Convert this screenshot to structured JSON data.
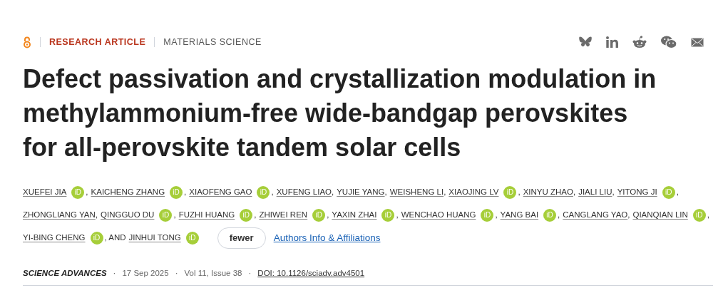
{
  "header": {
    "article_type": "RESEARCH ARTICLE",
    "subject": "MATERIALS SCIENCE"
  },
  "title": "Defect passivation and crystallization modulation in methylammonium-free wide-bandgap perovskites for all-perovskite tandem solar cells",
  "author_lines": [
    [
      {
        "name": "XUEFEI JIA",
        "orcid_badge": "iD",
        "after": ","
      },
      {
        "name": "KAICHENG ZHANG",
        "orcid_badge": "iD",
        "after": ","
      },
      {
        "name": "XIAOFENG GAO",
        "orcid_badge": "iD",
        "after": ","
      },
      {
        "name": "XUFENG LIAO",
        "after": ","
      },
      {
        "name": "YUJIE YANG",
        "after": ","
      },
      {
        "name": "WEISHENG LI",
        "after": ","
      },
      {
        "name": "XIAOJING LV",
        "orcid_badge": "iD",
        "after": ","
      },
      {
        "name": "XINYU ZHAO",
        "after": ","
      },
      {
        "name": "JIALI LIU",
        "after": ","
      },
      {
        "name": "YITONG JI",
        "orcid_badge": "iD",
        "after": ","
      }
    ],
    [
      {
        "name": "ZHONGLIANG YAN",
        "after": ","
      },
      {
        "name": "QINGGUO DU",
        "orcid_badge": "iD",
        "after": ","
      },
      {
        "name": "FUZHI HUANG",
        "orcid_badge": "iD",
        "after": ","
      },
      {
        "name": "ZHIWEI REN",
        "orcid_badge": "iD",
        "after": ","
      },
      {
        "name": "YAXIN ZHAI",
        "orcid_badge": "iD",
        "after": ","
      },
      {
        "name": "WENCHAO HUANG",
        "orcid_badge": "iD",
        "after": ","
      },
      {
        "name": "YANG BAI",
        "orcid_badge": "iD",
        "after": ","
      },
      {
        "name": "CANGLANG YAO",
        "after": ","
      },
      {
        "name": "QIANQIAN LIN",
        "orcid_badge": "iD",
        "after": ","
      }
    ],
    [
      {
        "name": "YI-BING CHENG",
        "orcid_badge": "iD",
        "after": ", AND"
      },
      {
        "name": "JINHUI TONG",
        "orcid_badge": "iD"
      }
    ]
  ],
  "fewer_button": "fewer",
  "affiliations_link": "Authors Info & Affiliations",
  "meta": [
    {
      "kind": "journal",
      "text": "SCIENCE ADVANCES"
    },
    {
      "kind": "separator",
      "text": "·"
    },
    {
      "kind": "date",
      "text": "17 Sep 2025"
    },
    {
      "kind": "separator",
      "text": "·"
    },
    {
      "kind": "volume",
      "text": "Vol 11, Issue 38"
    },
    {
      "kind": "separator",
      "text": "·"
    },
    {
      "kind": "doi",
      "text": "DOI: 10.1126/sciadv.adv4501"
    }
  ]
}
